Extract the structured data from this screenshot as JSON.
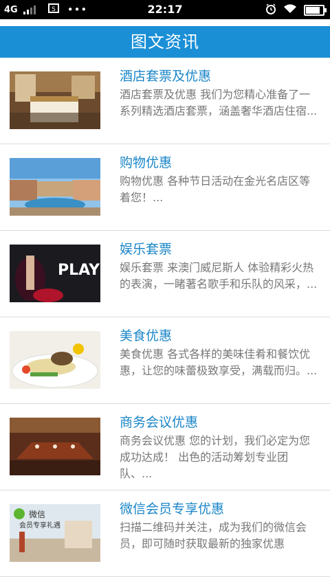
{
  "status_bar": {
    "network": "4G",
    "time": "22:17",
    "dots": "•••",
    "battery_level": 0.9
  },
  "header": {
    "title": "图文资讯"
  },
  "items": [
    {
      "title": "酒店套票及优惠",
      "desc": "酒店套票及优惠 我们为您精心准备了一系列精选酒店套票，涵盖奢华酒店住宿..."
    },
    {
      "title": "购物优惠",
      "desc": "购物优惠 各种节日活动在金光名店区等着您！..."
    },
    {
      "title": "娱乐套票",
      "desc": "娱乐套票 来澳门威尼斯人 体验精彩火热的表演，一睹著名歌手和乐队的风采，..."
    },
    {
      "title": "美食优惠",
      "desc": "美食优惠 各式各样的美味佳肴和餐饮优惠，让您的味蕾极致享受，满载而归。..."
    },
    {
      "title": "商务会议优惠",
      "desc": "商务会议优惠 您的计划，我们必定为您成功达成！ 出色的活动筹划专业团队、..."
    },
    {
      "title": "微信会员专享优惠",
      "desc": "扫描二维码并关注，成为我们的微信会员，即可随时获取最新的独家优惠"
    }
  ],
  "thumb_text": {
    "play": "PLAY",
    "wechat": "微信",
    "wechat_sub": "会员专享礼遇"
  }
}
